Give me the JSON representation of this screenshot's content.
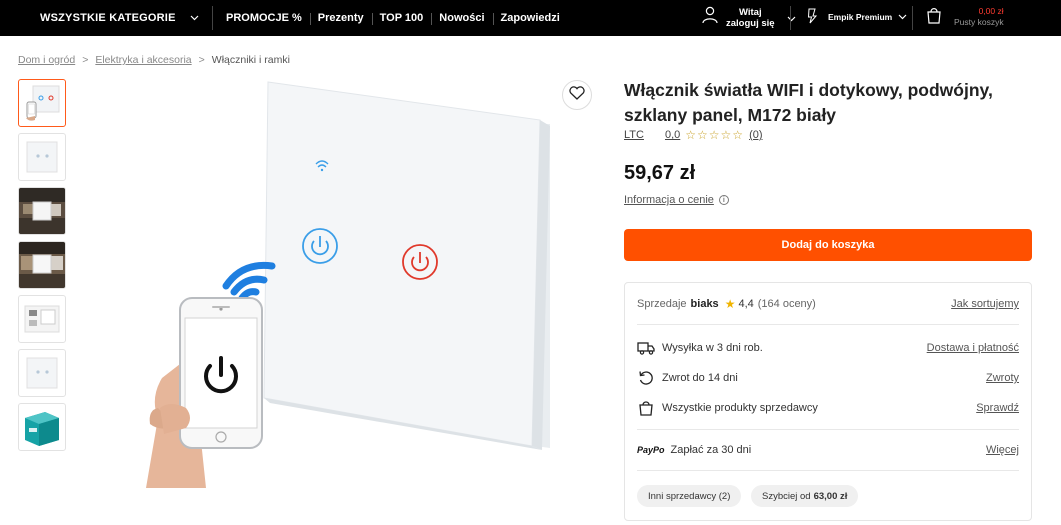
{
  "topbar": {
    "categories_label": "WSZYSTKIE KATEGORIE",
    "nav": [
      "PROMOCJE %",
      "Prezenty",
      "TOP 100",
      "Nowości",
      "Zapowiedzi"
    ],
    "account_line1": "Witaj",
    "account_line2": "zaloguj się",
    "premium_label": "Empik Premium",
    "cart_amount": "0,00 zł",
    "cart_status": "Pusty koszyk"
  },
  "breadcrumb": {
    "items": [
      "Dom i ogród",
      "Elektryka i akcesoria"
    ],
    "separator": ">",
    "current": "Włączniki i ramki"
  },
  "product": {
    "title": "Włącznik światła WIFI i dotykowy, podwójny, szklany panel, M172 biały",
    "brand": "LTC",
    "rating": "0,0",
    "stars": "☆☆☆☆☆",
    "rating_count": "(0)",
    "price": "59,67 zł",
    "price_info": "Informacja o cenie",
    "add_to_cart": "Dodaj do koszyka"
  },
  "seller": {
    "sold_by_label": "Sprzedaje",
    "seller_name": "biaks",
    "seller_rating": "4,4",
    "seller_rating_count": "(164 oceny)",
    "sort_link": "Jak sortujemy",
    "shipping": "Wysyłka w 3 dni rob.",
    "shipping_link": "Dostawa i płatność",
    "returns": "Zwrot do 14 dni",
    "returns_link": "Zwroty",
    "all_products": "Wszystkie produkty sprzedawcy",
    "all_products_link": "Sprawdź",
    "paypo_brand": "PayPo",
    "paypo_text": "Zapłać za 30 dni",
    "paypo_link": "Więcej",
    "other_sellers": "Inni sprzedawcy (2)",
    "faster_prefix": "Szybciej od",
    "faster_amount": "63,00 zł"
  },
  "icons": {
    "heart": "heart-icon",
    "cart": "cart-icon",
    "user": "user-icon",
    "truck": "truck-icon",
    "return": "return-icon",
    "bag": "bag-icon"
  },
  "colors": {
    "accent": "#ff5000",
    "topbar": "#000000",
    "cart_amount": "#ff3b30",
    "power_blue": "#3a9ee8",
    "power_red": "#e0392b"
  }
}
